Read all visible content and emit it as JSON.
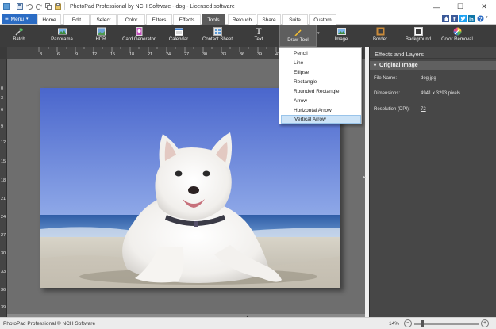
{
  "window": {
    "title": "PhotoPad Professional by NCH Software - dog - Licensed software",
    "minimize": "—",
    "maximize": "☐",
    "close": "✕"
  },
  "menu_button": {
    "label": "Menu",
    "icon": "hamburger-icon"
  },
  "tabs": [
    {
      "label": "Home"
    },
    {
      "label": "Edit"
    },
    {
      "label": "Select"
    },
    {
      "label": "Color"
    },
    {
      "label": "Filters"
    },
    {
      "label": "Effects"
    },
    {
      "label": "Tools",
      "active": true
    },
    {
      "label": "Retouch"
    },
    {
      "label": "Share"
    },
    {
      "label": "Suite"
    },
    {
      "label": "Custom"
    }
  ],
  "toolbar": {
    "items": [
      {
        "label": "Batch",
        "icon": "batch-icon"
      },
      {
        "label": "Panorama",
        "icon": "panorama-icon"
      },
      {
        "label": "HDR",
        "icon": "hdr-icon"
      },
      {
        "label": "Card Generator",
        "icon": "card-generator-icon"
      },
      {
        "label": "Calendar",
        "icon": "calendar-icon"
      },
      {
        "label": "Contact Sheet",
        "icon": "contact-sheet-icon"
      },
      {
        "label": "Text",
        "icon": "text-icon"
      },
      {
        "label": "Draw Tool",
        "icon": "pencil-icon",
        "pressed": true
      },
      {
        "label": "Image",
        "icon": "image-icon"
      },
      {
        "label": "Border",
        "icon": "border-icon"
      },
      {
        "label": "Background",
        "icon": "background-icon"
      },
      {
        "label": "Color Removal",
        "icon": "color-removal-icon"
      }
    ]
  },
  "draw_menu": {
    "items": [
      "Pencil",
      "Line",
      "Ellipse",
      "Rectangle",
      "Rounded Rectangle",
      "Arrow",
      "Horizontal Arrow",
      "Vertical Arrow"
    ],
    "selected": "Vertical Arrow"
  },
  "ruler": {
    "top": [
      "3",
      "6",
      "9",
      "12",
      "15",
      "18",
      "21",
      "24",
      "27",
      "30",
      "33",
      "36",
      "39",
      "42",
      "45"
    ],
    "left": [
      "0",
      "3",
      "6",
      "9",
      "12",
      "15",
      "18",
      "21",
      "24",
      "27",
      "30",
      "33",
      "36",
      "39"
    ]
  },
  "panel": {
    "title": "Effects and Layers",
    "section": "Original Image",
    "file_name_label": "File Name:",
    "file_name": "dog.jpg",
    "dimensions_label": "Dimensions:",
    "dimensions": "4941 x 3293 pixels",
    "resolution_label": "Resolution (DPI):",
    "resolution": "72"
  },
  "status": {
    "text": "PhotoPad Professional © NCH Software",
    "zoom": "14%",
    "zoom_level": 0.1
  },
  "colors": {
    "accent": "#2b6cc4",
    "toolbar_bg": "#3c3c3c",
    "panel_bg": "#474747",
    "menu_selected": "#cce3f7"
  }
}
